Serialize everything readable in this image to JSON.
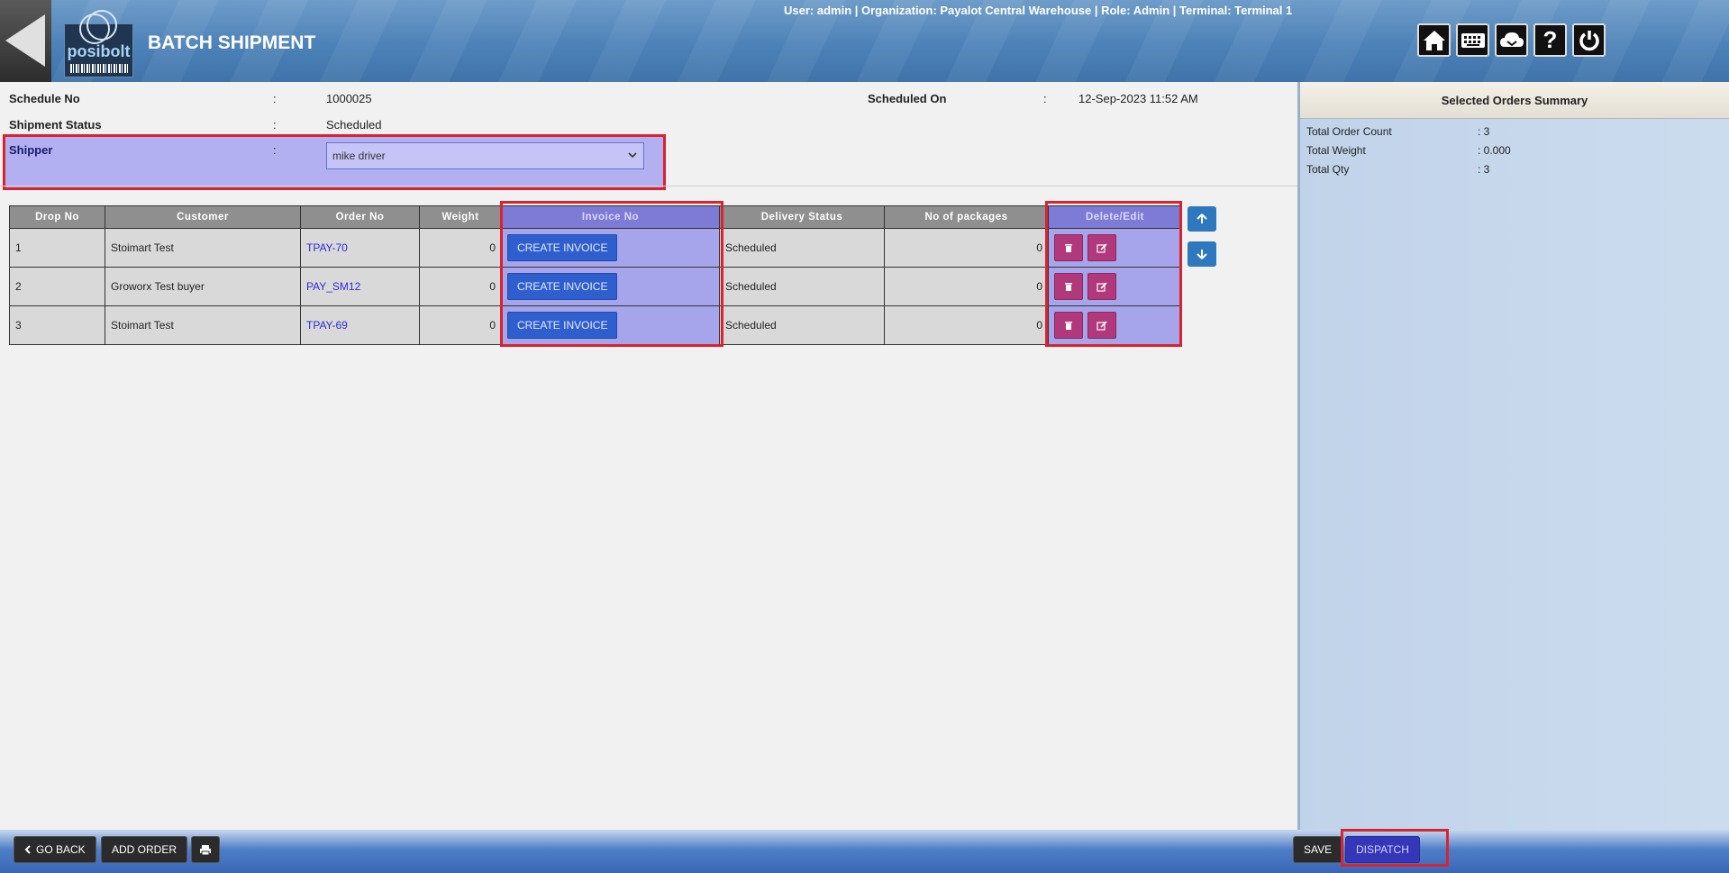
{
  "header": {
    "title": "BATCH SHIPMENT",
    "brand": "posibolt",
    "user_info": "User: admin | Organization: Payalot Central Warehouse | Role: Admin | Terminal: Terminal 1",
    "icons": [
      "home-icon",
      "keyboard-icon",
      "cloud-icon",
      "help-icon",
      "power-icon"
    ]
  },
  "form": {
    "schedule_no_label": "Schedule No",
    "schedule_no_value": "1000025",
    "shipment_status_label": "Shipment Status",
    "shipment_status_value": "Scheduled",
    "shipper_label": "Shipper",
    "shipper_value": "mike driver",
    "scheduled_on_label": "Scheduled On",
    "scheduled_on_value": "12-Sep-2023 11:52 AM",
    "colon": ":"
  },
  "table": {
    "headers": [
      "Drop No",
      "Customer",
      "Order No",
      "Weight",
      "Invoice No",
      "Delivery Status",
      "No of packages",
      "Delete/Edit"
    ],
    "create_invoice_label": "CREATE INVOICE",
    "rows": [
      {
        "drop_no": "1",
        "customer": "Stoimart Test",
        "order_no": "TPAY-70",
        "weight": "0",
        "status": "Scheduled",
        "packages": "0"
      },
      {
        "drop_no": "2",
        "customer": "Groworx Test buyer",
        "order_no": "PAY_SM12",
        "weight": "0",
        "status": "Scheduled",
        "packages": "0"
      },
      {
        "drop_no": "3",
        "customer": "Stoimart Test",
        "order_no": "TPAY-69",
        "weight": "0",
        "status": "Scheduled",
        "packages": "0"
      }
    ]
  },
  "summary": {
    "title": "Selected Orders Summary",
    "total_order_count_label": "Total Order Count",
    "total_order_count_value": ": 3",
    "total_weight_label": "Total Weight",
    "total_weight_value": ": 0.000",
    "total_qty_label": "Total Qty",
    "total_qty_value": ": 3"
  },
  "footer": {
    "go_back_label": "GO BACK",
    "add_order_label": "ADD ORDER",
    "save_label": "SAVE",
    "dispatch_label": "DISPATCH"
  },
  "colors": {
    "highlight_border": "#d9232f",
    "highlight_fill": "#b2b0f0",
    "create_invoice": "#2f5fcf",
    "delete_edit": "#b1387a"
  }
}
